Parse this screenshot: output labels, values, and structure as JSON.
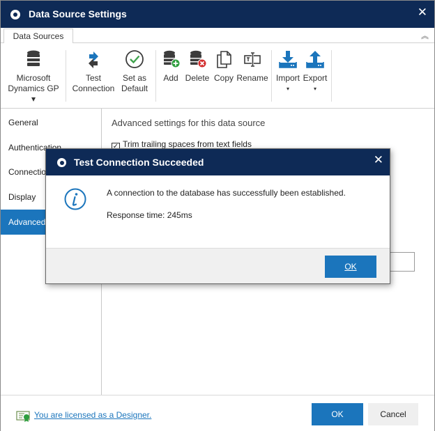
{
  "window": {
    "title": "Data Source Settings",
    "close_symbol": "✕"
  },
  "ribbon": {
    "tab_label": "Data Sources",
    "collapse_symbol": "︽",
    "buttons": [
      {
        "line1": "Microsoft",
        "line2": "Dynamics GP ▾",
        "icon": "database-icon"
      },
      {
        "line1": "Test",
        "line2": "Connection",
        "icon": "test-connection-icon"
      },
      {
        "line1": "Set as",
        "line2": "Default",
        "icon": "checkmark-circle-icon"
      },
      {
        "line1": "Add",
        "icon": "database-add-icon"
      },
      {
        "line1": "Delete",
        "icon": "database-delete-icon"
      },
      {
        "line1": "Copy",
        "icon": "copy-icon"
      },
      {
        "line1": "Rename",
        "icon": "rename-icon"
      },
      {
        "line1": "Import",
        "line2": "▾",
        "icon": "import-icon"
      },
      {
        "line1": "Export",
        "line2": "▾",
        "icon": "export-icon"
      }
    ]
  },
  "sidebar": {
    "items": [
      {
        "label": "General"
      },
      {
        "label": "Authentication"
      },
      {
        "label": "Connection"
      },
      {
        "label": "Display"
      },
      {
        "label": "Advanced"
      }
    ]
  },
  "content": {
    "section_title": "Advanced settings for this data source",
    "checkbox_label": "Trim trailing spaces from text fields",
    "checkbox_checked": true
  },
  "footer": {
    "license_text": "You are licensed as a Designer.",
    "ok_label": "OK",
    "cancel_label": "Cancel"
  },
  "dialog": {
    "title": "Test Connection Succeeded",
    "close_symbol": "✕",
    "message": "A connection to the database has successfully been established.",
    "response": "Response time: 245ms",
    "ok_label": "OK"
  },
  "colors": {
    "titlebar": "#0e2a56",
    "accent": "#1b75bc",
    "icon_dark": "#3c3c3c",
    "icon_blue": "#1b75bc",
    "add_green": "#2e9e3e",
    "delete_red": "#d32f2f",
    "check_green": "#3fa34d"
  }
}
